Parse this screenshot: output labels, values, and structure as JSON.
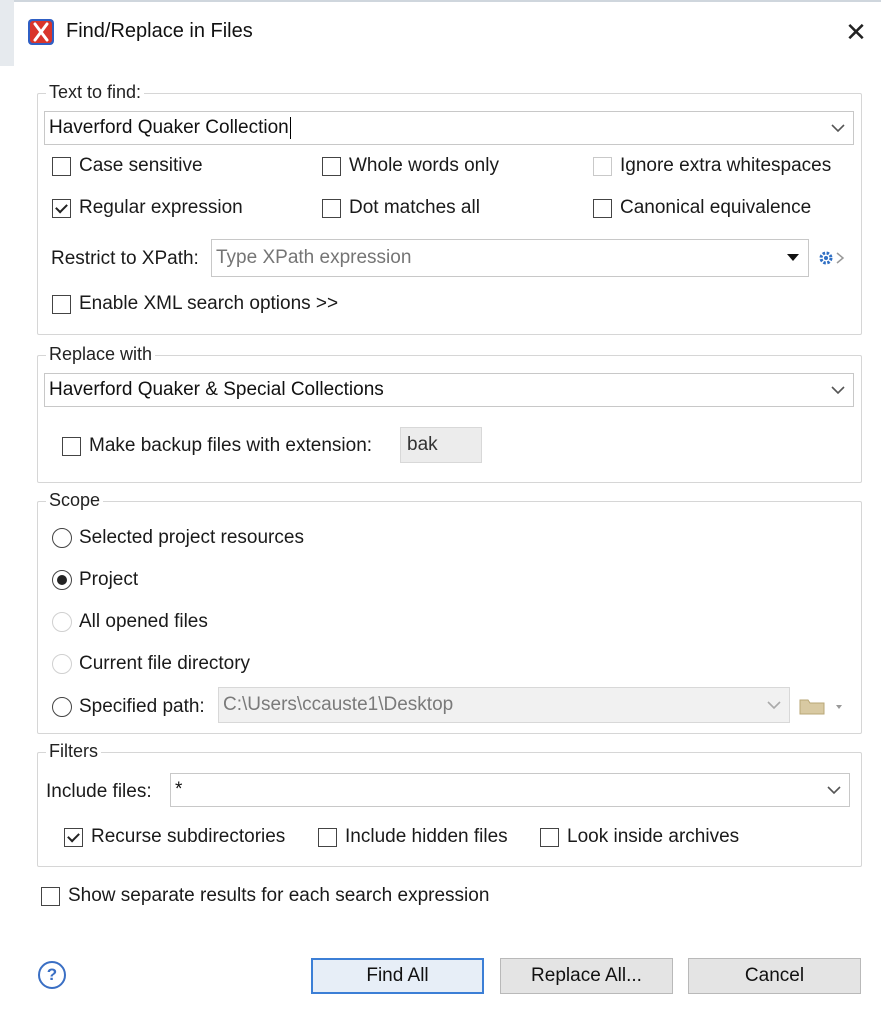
{
  "window": {
    "title": "Find/Replace in Files",
    "close_glyph": "✕"
  },
  "find": {
    "legend": "Text to find:",
    "value": "Haverford Quaker Collection",
    "options": {
      "case_sensitive": {
        "label": "Case sensitive",
        "checked": false
      },
      "whole_words": {
        "label": "Whole words only",
        "checked": false
      },
      "ignore_whitespace": {
        "label": "Ignore extra whitespaces",
        "checked": false,
        "enabled": false
      },
      "regex": {
        "label": "Regular expression",
        "checked": true
      },
      "dot_all": {
        "label": "Dot matches all",
        "checked": false
      },
      "canonical": {
        "label": "Canonical equivalence",
        "checked": false
      }
    },
    "xpath_label": "Restrict to XPath:",
    "xpath_placeholder": "Type XPath expression",
    "xml_options_label": "Enable XML search options >>"
  },
  "replace": {
    "legend": "Replace with",
    "value": "Haverford Quaker & Special Collections",
    "backup_label": "Make backup files with extension:",
    "backup_ext": "bak"
  },
  "scope": {
    "legend": "Scope",
    "selected_resources": "Selected project resources",
    "project": "Project",
    "all_opened": "All opened files",
    "current_dir": "Current file directory",
    "specified_path": "Specified path:",
    "path_value": "C:\\Users\\ccauste1\\Desktop"
  },
  "filters": {
    "legend": "Filters",
    "include_label": "Include files:",
    "include_value": "*",
    "recurse": "Recurse subdirectories",
    "hidden": "Include hidden files",
    "archives": "Look inside archives"
  },
  "separate_results": "Show separate results for each search expression",
  "buttons": {
    "help": "?",
    "find_all": "Find All",
    "replace_all": "Replace All...",
    "cancel": "Cancel"
  },
  "colors": {
    "accent": "#3c7fd6",
    "icon_red": "#d9352b",
    "icon_blue": "#2f5fc4"
  }
}
